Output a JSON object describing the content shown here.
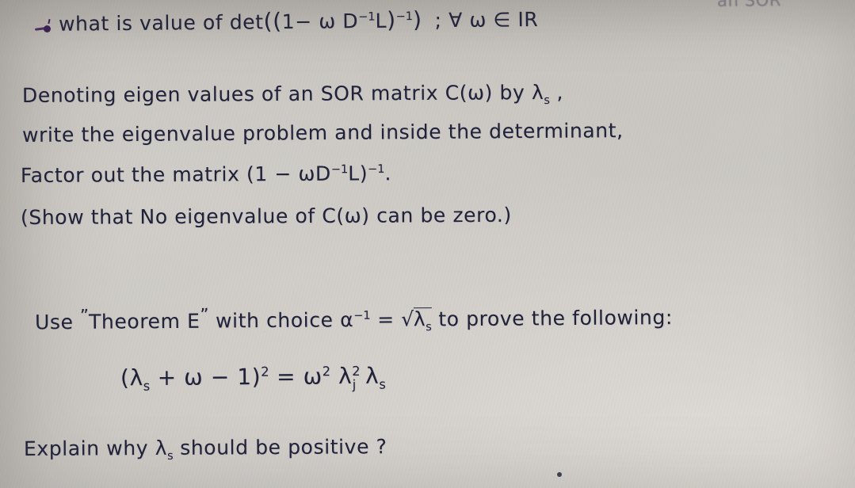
{
  "document": {
    "kind": "handwritten-math-notes",
    "subject_topic": "SOR matrix eigenvalues",
    "ink_color": "#20223a",
    "accent_ink_color": "#3a2250",
    "paper_color": "#c9c6c1"
  },
  "cropped_header": {
    "text": "an SOR"
  },
  "lines": {
    "question_prefix": "what is value of det",
    "question_expr_open": "((",
    "question_expr_inner": "1− ω D",
    "question_inner_exp": "−1",
    "question_inner_L": "L",
    "question_expr_close": ")",
    "question_outer_exp": "−1",
    "question_expr_end": ")",
    "question_quantifier": "; ∀ ω ∈ IR",
    "denoting": "Denoting eigen values of an SOR matrix C(ω) by λ",
    "denoting_sub": "s",
    "denoting_tail": " ,",
    "write": "write the eigenvalue problem and inside the determinant,",
    "factor_prefix": "Factor out the matrix  (1 − ωD",
    "factor_exp1": "−1",
    "factor_mid": "L)",
    "factor_exp2": "−1",
    "factor_tail": ".",
    "show": "(Show that  No eigenvalue of  C(ω)  can be zero.)",
    "use_prefix": "Use ",
    "use_quote_open": "”",
    "use_theorem": "Theorem E",
    "use_quote_close": "”",
    "use_mid": " with choice  α",
    "use_alpha_exp": "−1",
    "use_eq": " = ",
    "use_sqrt_sym": "√",
    "use_sqrt_lambda": "λ",
    "use_sqrt_sub": "s",
    "use_tail": "  to prove the following:",
    "equation_lhs_open": "(λ",
    "equation_lhs_sub": "s",
    "equation_lhs_mid": " + ω − 1)",
    "equation_lhs_exp": "2",
    "equation_eq": " = ",
    "equation_rhs_omega": "ω",
    "equation_rhs_omega_exp": "2",
    "equation_rhs_lambda_j": "λ",
    "equation_rhs_j_exp": "2",
    "equation_rhs_j_sub": "j",
    "equation_rhs_lambda_s": "λ",
    "equation_rhs_s_sub": "s",
    "explain_prefix": "Explain why λ",
    "explain_sub": "s",
    "explain_tail": " should be positive ?"
  },
  "plain_text_transcript": {
    "l1": "• what is value of det((1−ωD⁻¹L)⁻¹) ; ∀ ω ∈ IR",
    "l2": "Denoting eigen values of an SOR matrix C(ω) by λₛ ,",
    "l3": "write the eigenvalue problem and inside the determinant,",
    "l4": "Factor out the matrix (1−ωD⁻¹L)⁻¹.",
    "l5": "(Show that No eigenvalue of C(ω) can be zero.)",
    "l6": "Use “Theorem E” with choice α⁻¹ = √λₛ to prove the following:",
    "l7": "(λₛ + ω − 1)² = ω² λⱼ² λₛ",
    "l8": "Explain why λₛ should be positive ?"
  }
}
